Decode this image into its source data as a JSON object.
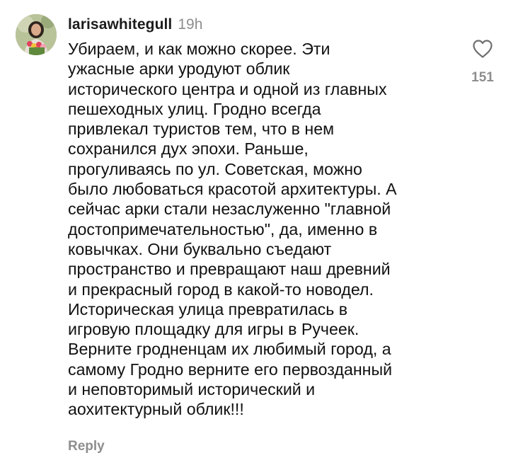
{
  "comment": {
    "username": "larisawhitegull",
    "time_ago": "19h",
    "text": "Убираем, и как можно скорее. Эти\nужасные арки уродуют облик\nисторического центра и одной из главных\nпешеходных улиц. Гродно всегда\nпривлекал туристов тем, что в нем\nсохранился дух эпохи. Раньше,\nпрогуливаясь по ул. Советская, можно\nбыло любоваться красотой архитектуры. А\nсейчас арки стали незаслуженно \"главной\nдостопримечательностью\", да, именно в\nковычках. Они буквально съедают\nпространство и превращают наш древний\nи прекрасный город в какой-то новодел.\nИсторическая улица превратилась в\nигровую площадку для игры в Ручеек.\nВерните гродненцам их любимый город, а\nсамому Гродно верните его первозданный\nи неповторимый исторический и\nаохитектурный  облик!!!",
    "like_count": "151",
    "reply_label": "Reply",
    "icons": {
      "like": "heart-outline-icon",
      "avatar": "user-avatar-photo"
    },
    "colors": {
      "meta_gray": "#8e8e8e",
      "text": "#111111"
    }
  }
}
